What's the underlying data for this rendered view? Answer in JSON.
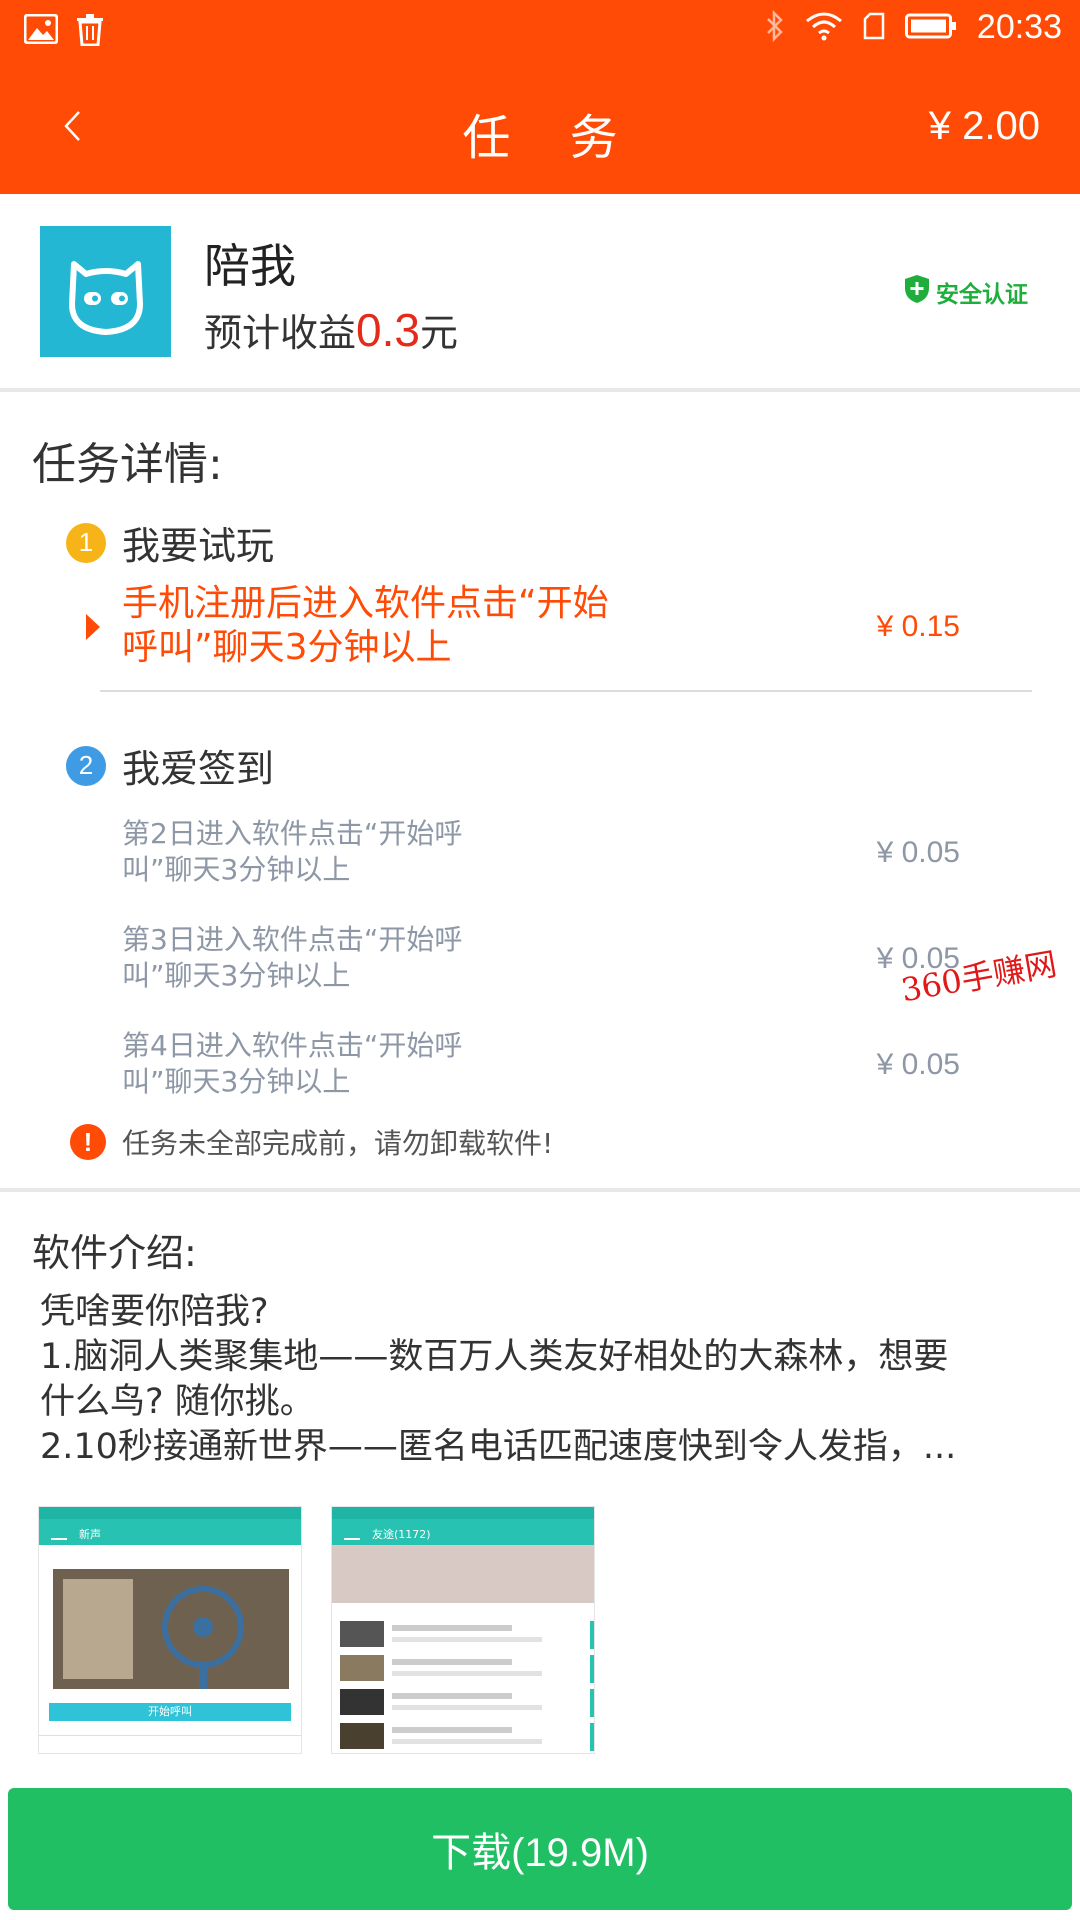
{
  "status_bar": {
    "time": "20:33"
  },
  "header": {
    "title": "任 务",
    "balance": "¥ 2.00"
  },
  "app": {
    "name": "陪我",
    "earn_prefix": "预计收益",
    "earn_amount": "0.3",
    "earn_suffix": "元",
    "secure_label": "安全认证"
  },
  "details": {
    "title": "任务详情:",
    "steps": [
      {
        "num": "1",
        "label": "我要试玩",
        "color": "#f6b418",
        "tasks": [
          {
            "line1": "手机注册后进入软件点击“开始",
            "line2": "呼叫”聊天3分钟以上",
            "price": "¥ 0.15"
          }
        ]
      },
      {
        "num": "2",
        "label": "我爱签到",
        "color": "#3e9be4",
        "tasks": [
          {
            "line1": "第2日进入软件点击“开始呼",
            "line2": "叫”聊天3分钟以上",
            "price": "¥ 0.05"
          },
          {
            "line1": "第3日进入软件点击“开始呼",
            "line2": "叫”聊天3分钟以上",
            "price": "¥ 0.05"
          },
          {
            "line1": "第4日进入软件点击“开始呼",
            "line2": "叫”聊天3分钟以上",
            "price": "¥ 0.05"
          }
        ]
      }
    ],
    "warning": "任务未全部完成前，请勿卸载软件!"
  },
  "watermark": "360手赚网",
  "intro": {
    "title": "软件介绍:",
    "lines": [
      "凭啥要你陪我?",
      "1.脑洞人类聚集地——数百万人类友好相处的大森林，想要",
      "什么鸟? 随你挑。",
      "2.10秒接通新世界——匿名电话匹配速度快到令人发指，..."
    ]
  },
  "screenshots": [
    {
      "title": "新声",
      "button": "开始呼叫"
    },
    {
      "title": "友途(1172)"
    }
  ],
  "download": {
    "label": "下载(19.9M)"
  },
  "colors": {
    "brand": "#ff4b06",
    "download": "#21bf63",
    "red": "#e62a1a",
    "app_icon": "#23b7d3"
  }
}
